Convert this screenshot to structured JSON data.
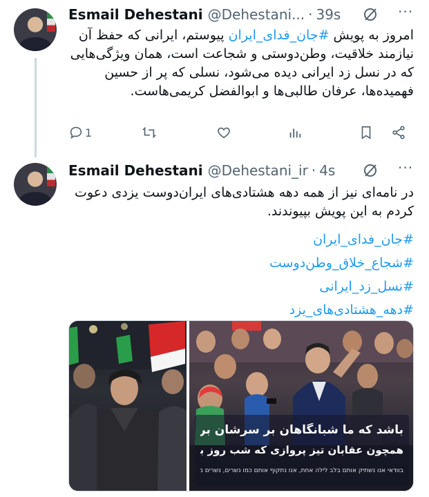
{
  "tweets": [
    {
      "author": "Esmail Dehestani",
      "handle": "@Dehestani...",
      "time": "39s",
      "text_pre": "امروز به پویش ",
      "hashtag": "#جان_فدای_ایران",
      "text_post": " پیوستم، ایرانی که حفظ آن نیازمند خلاقیت، وطن‌دوستی و شجاعت است، همان ویژگی‌هایی که در نسل زد ایرانی دیده می‌شود، نسلی که پر از حسین فهمیده‌ها، عرفان طالبی‌ها و ابوالفضل کریمی‌هاست.",
      "reply_count": "1"
    },
    {
      "author": "Esmail Dehestani",
      "handle": "@Dehestani_ir",
      "time": "4s",
      "text": "در نامه‌ای نیز از همه دهه هشتادی‌های ایران‌دوست یزدی دعوت کردم به این پویش بپیوندند.",
      "hashtags": [
        "#جان_فدای_ایران",
        "#شجاع_خلاق_وطن‌دوست",
        "#نسل_زد_ایرانی",
        "#دهه_هشتادی‌های_یزد"
      ],
      "image_caption_line1": "باشد که ما شبانگاهان بر سرشان بریزیم،",
      "image_caption_line2": "همچون عقابان تیز پروازی که شب‌ روز براشان معنا ندارد.",
      "image_caption_line3": "בוודאי אנו נשתיק אותם בלב לילה אחת, אנו נתקוף אותם כמו נשרים, נשרים ממהרים שאין להם הבדל בין לילה ליום"
    }
  ],
  "colors": {
    "accent": "#1d9bf0",
    "muted": "#536471",
    "divider": "#cfd9de"
  },
  "icons": [
    "grok-icon",
    "more-icon",
    "reply-icon",
    "retweet-icon",
    "like-icon",
    "views-icon",
    "bookmark-icon",
    "share-icon"
  ]
}
